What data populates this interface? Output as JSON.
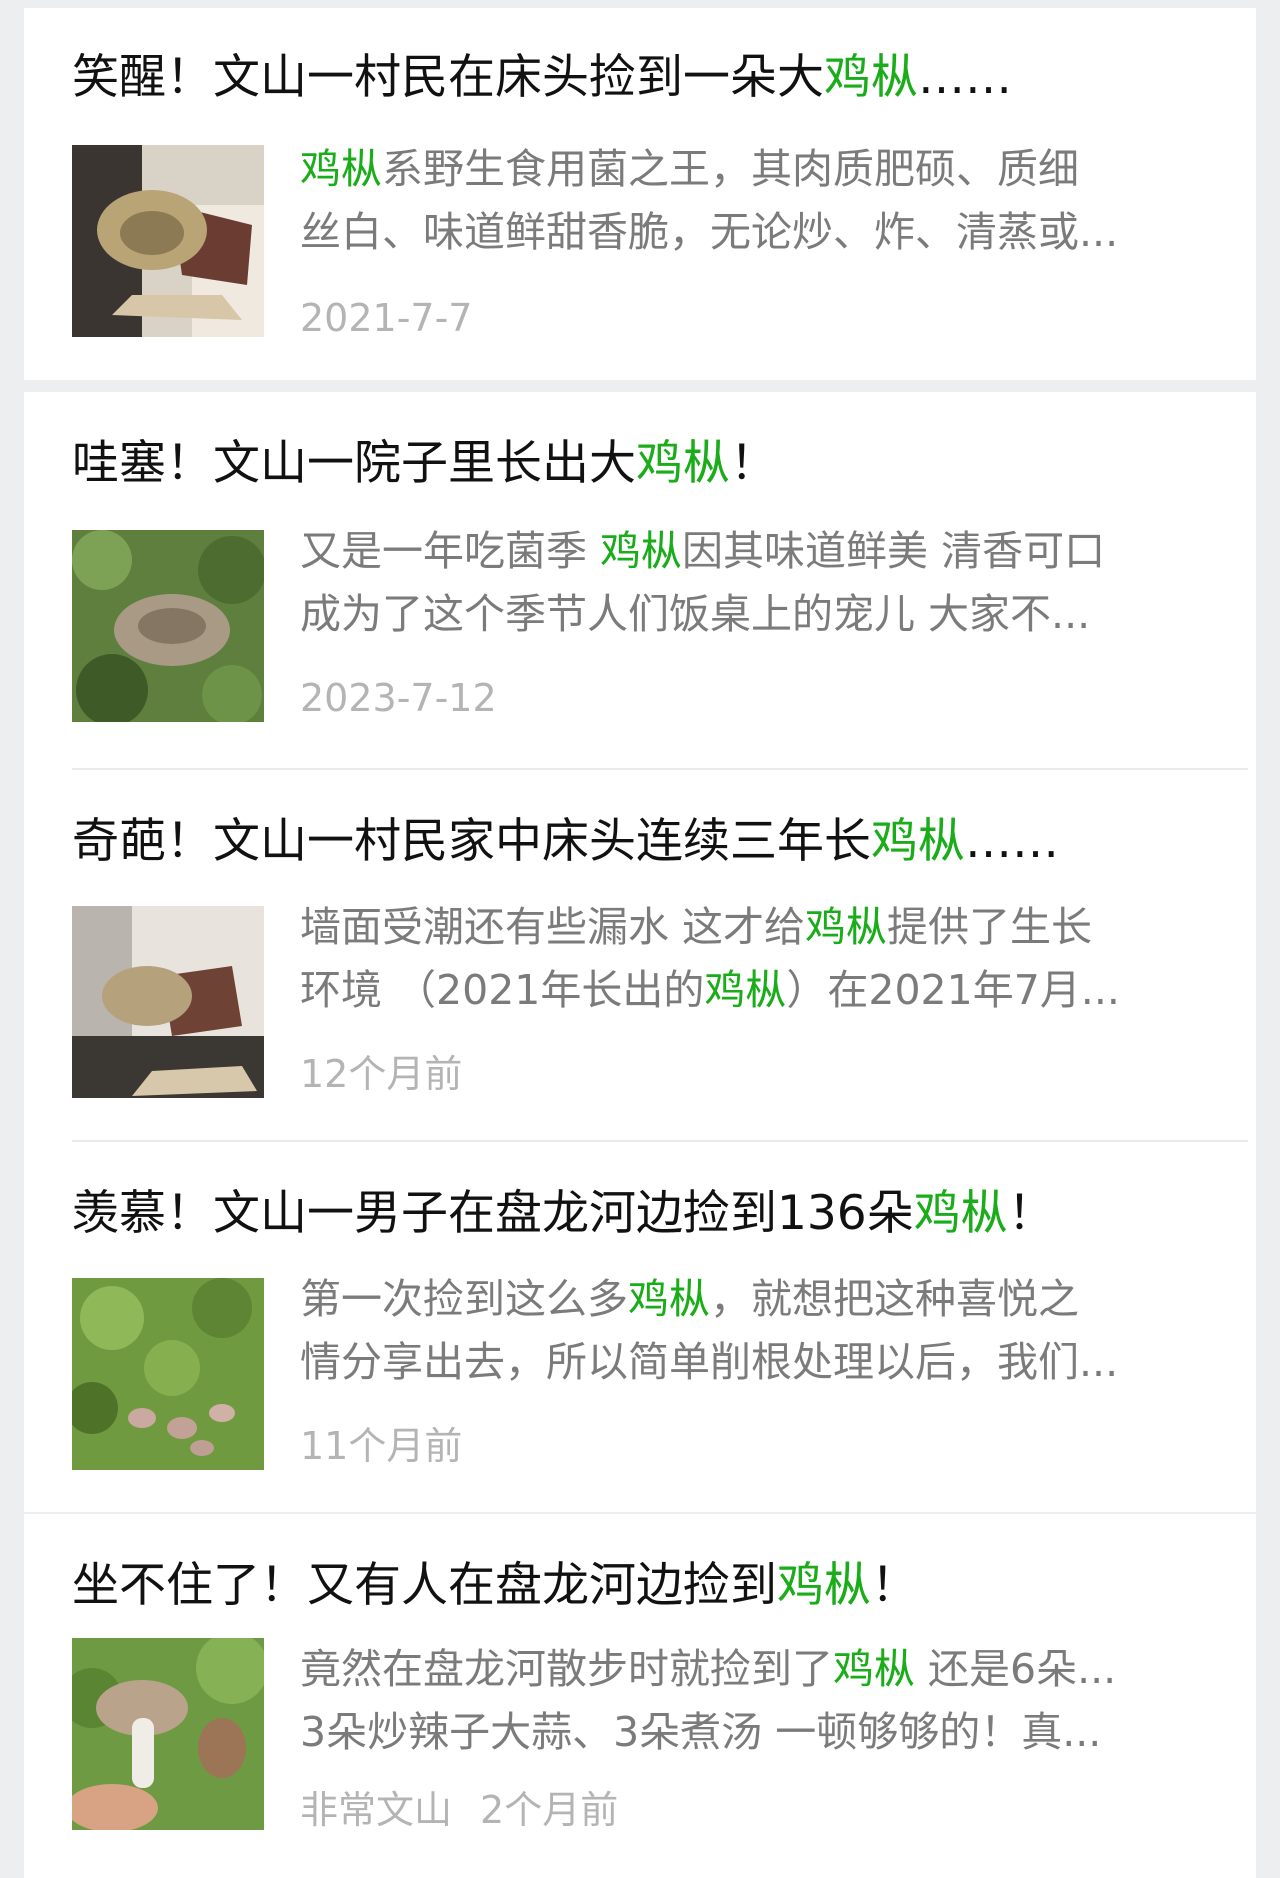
{
  "keyword_color": "#1aad19",
  "articles": [
    {
      "title_pre": "笑醒！文山一村民在床头捡到一朵大",
      "title_kw": "鸡枞",
      "title_post": "……",
      "line1_pre": "",
      "line1_kw": "鸡枞",
      "line1_post": "系野生食用菌之王，其肉质肥硕、质细",
      "line2_pre": "丝白、味道鲜甜香脆，无论炒、炸、清蒸或...",
      "line2_kw": "",
      "line2_post": "",
      "source": "",
      "date": "2021-7-7",
      "thumb_icon": "mushroom-bedroom-photo"
    },
    {
      "title_pre": "哇塞！文山一院子里长出大",
      "title_kw": "鸡枞",
      "title_post": "！",
      "line1_pre": "又是一年吃菌季 ",
      "line1_kw": "鸡枞",
      "line1_post": "因其味道鲜美 清香可口",
      "line2_pre": "成为了这个季节人们饭桌上的宠儿 大家不...",
      "line2_kw": "",
      "line2_post": "",
      "source": "",
      "date": "2023-7-12",
      "thumb_icon": "mushroom-garden-photo"
    },
    {
      "title_pre": "奇葩！文山一村民家中床头连续三年长",
      "title_kw": "鸡枞",
      "title_post": "……",
      "line1_pre": "墙面受潮还有些漏水 这才给",
      "line1_kw": "鸡枞",
      "line1_post": "提供了生长",
      "line2_pre": "环境 （2021年长出的",
      "line2_kw": "鸡枞",
      "line2_post": "）在2021年7月...",
      "source": "",
      "date": "12个月前",
      "thumb_icon": "mushroom-wall-photo"
    },
    {
      "title_pre": "羡慕！文山一男子在盘龙河边捡到136朵",
      "title_kw": "鸡枞",
      "title_post": "！",
      "line1_pre": "第一次捡到这么多",
      "line1_kw": "鸡枞",
      "line1_post": "，就想把这种喜悦之",
      "line2_pre": "情分享出去，所以简单削根处理以后，我们...",
      "line2_kw": "",
      "line2_post": "",
      "source": "",
      "date": "11个月前",
      "thumb_icon": "mushroom-grass-photo"
    },
    {
      "title_pre": "坐不住了！又有人在盘龙河边捡到",
      "title_kw": "鸡枞",
      "title_post": "！",
      "line1_pre": "竟然在盘龙河散步时就捡到了",
      "line1_kw": "鸡枞",
      "line1_post": " 还是6朵...",
      "line2_pre": "3朵炒辣子大蒜、3朵煮汤 一顿够够的！真...",
      "line2_kw": "",
      "line2_post": "",
      "source": "非常文山",
      "date": "2个月前",
      "thumb_icon": "mushroom-hand-photo"
    }
  ]
}
